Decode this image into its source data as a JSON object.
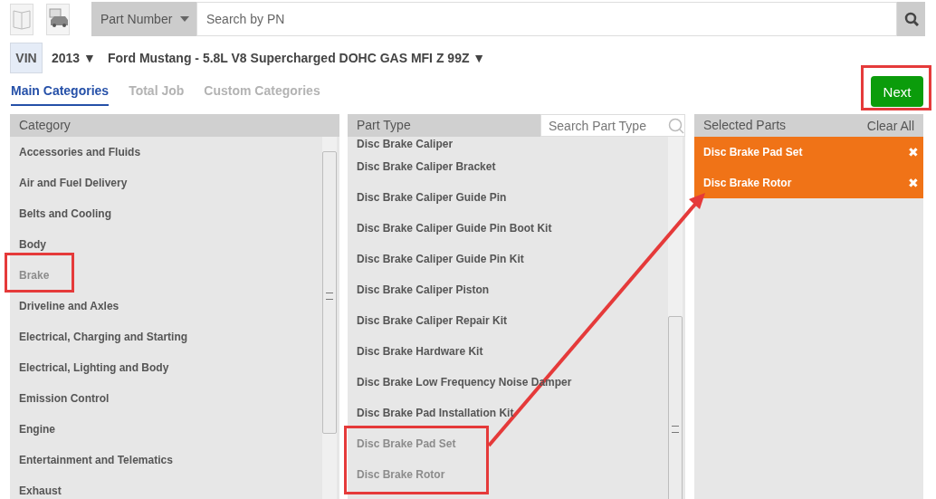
{
  "toolbar": {
    "search_type": "Part Number",
    "search": {
      "placeholder": "Search by PN"
    }
  },
  "vehicle": {
    "vin_label": "VIN",
    "year": "2013 ▼",
    "model": "Ford Mustang - 5.8L V8 Supercharged DOHC GAS MFI Z 99Z ▼"
  },
  "tabs": [
    {
      "label": "Main Categories",
      "selected": true
    },
    {
      "label": "Total Job",
      "selected": false
    },
    {
      "label": "Custom Categories",
      "selected": false
    }
  ],
  "next_button": "Next",
  "category_panel": {
    "title": "Category",
    "items": [
      {
        "label": "Accessories and Fluids",
        "selected": false
      },
      {
        "label": "Air and Fuel Delivery",
        "selected": false
      },
      {
        "label": "Belts and Cooling",
        "selected": false
      },
      {
        "label": "Body",
        "selected": false
      },
      {
        "label": "Brake",
        "selected": true
      },
      {
        "label": "Driveline and Axles",
        "selected": false
      },
      {
        "label": "Electrical, Charging and Starting",
        "selected": false
      },
      {
        "label": "Electrical, Lighting and Body",
        "selected": false
      },
      {
        "label": "Emission Control",
        "selected": false
      },
      {
        "label": "Engine",
        "selected": false
      },
      {
        "label": "Entertainment and Telematics",
        "selected": false
      },
      {
        "label": "Exhaust",
        "selected": false
      }
    ]
  },
  "part_type_panel": {
    "title": "Part Type",
    "search": {
      "placeholder": "Search Part Type"
    },
    "items": [
      {
        "label": "Disc Brake Caliper",
        "selected": false
      },
      {
        "label": "Disc Brake Caliper Bracket",
        "selected": false
      },
      {
        "label": "Disc Brake Caliper Guide Pin",
        "selected": false
      },
      {
        "label": "Disc Brake Caliper Guide Pin Boot Kit",
        "selected": false
      },
      {
        "label": "Disc Brake Caliper Guide Pin Kit",
        "selected": false
      },
      {
        "label": "Disc Brake Caliper Piston",
        "selected": false
      },
      {
        "label": "Disc Brake Caliper Repair Kit",
        "selected": false
      },
      {
        "label": "Disc Brake Hardware Kit",
        "selected": false
      },
      {
        "label": "Disc Brake Low Frequency Noise Damper",
        "selected": false
      },
      {
        "label": "Disc Brake Pad Installation Kit",
        "selected": false
      },
      {
        "label": "Disc Brake Pad Set",
        "selected": true
      },
      {
        "label": "Disc Brake Rotor",
        "selected": true
      }
    ]
  },
  "selected_panel": {
    "title": "Selected Parts",
    "clear_all": "Clear All",
    "items": [
      {
        "label": "Disc Brake Pad Set",
        "remove": "✖"
      },
      {
        "label": "Disc Brake Rotor",
        "remove": "✖"
      }
    ]
  }
}
